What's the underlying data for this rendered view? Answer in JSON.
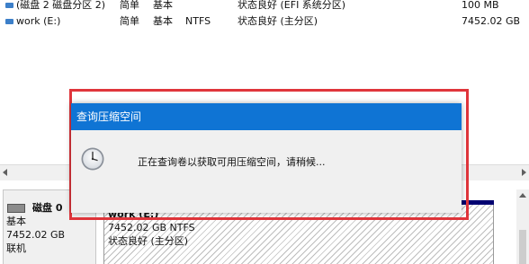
{
  "volumes": [
    {
      "name": "(磁盘 2 磁盘分区 2)",
      "layout": "简单",
      "type": "基本",
      "fs": "",
      "status": "状态良好 (EFI 系统分区)",
      "capacity": "100 MB"
    },
    {
      "name": "work (E:)",
      "layout": "简单",
      "type": "基本",
      "fs": "NTFS",
      "status": "状态良好 (主分区)",
      "capacity": "7452.02 GB"
    }
  ],
  "disk": {
    "title": "磁盘 0",
    "type": "基本",
    "size": "7452.02 GB",
    "state": "联机"
  },
  "partition": {
    "name": "work  (E:)",
    "size_fs": "7452.02 GB NTFS",
    "status": "状态良好 (主分区)"
  },
  "dialog": {
    "title": "查询压缩空间",
    "message": "正在查询卷以获取可用压缩空间，请稍候..."
  },
  "colors": {
    "dialog_title_bar": "#0f74d4",
    "highlight_border": "#e0353b",
    "partition_bar": "#000070"
  },
  "icons": {
    "volume": "volume-icon",
    "disk": "disk-icon",
    "dialog": "clock-icon"
  }
}
